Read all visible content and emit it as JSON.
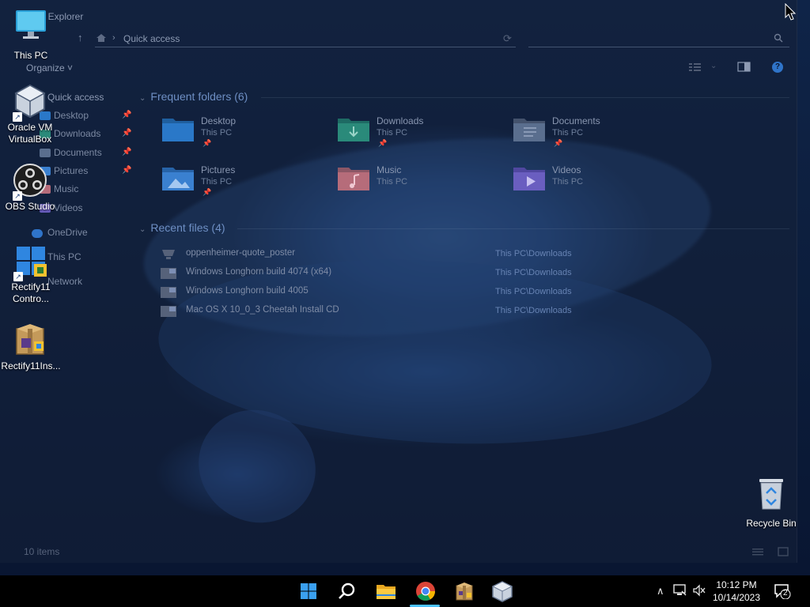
{
  "explorer": {
    "title": "File Explorer",
    "breadcrumb": "Quick access",
    "organize_label": "Organize ˅",
    "help_label": "?",
    "status_text": "10 items"
  },
  "nav": {
    "quick_access": "Quick access",
    "pinned": [
      {
        "label": "Desktop"
      },
      {
        "label": "Downloads"
      },
      {
        "label": "Documents"
      },
      {
        "label": "Pictures"
      },
      {
        "label": "Music"
      },
      {
        "label": "Videos"
      }
    ],
    "onedrive": "OneDrive",
    "this_pc": "This PC",
    "network": "Network"
  },
  "frequent": {
    "heading": "Frequent folders (6)",
    "folders": [
      {
        "name": "Desktop",
        "location": "This PC",
        "icon": "desktop-folder-icon"
      },
      {
        "name": "Downloads",
        "location": "This PC",
        "icon": "downloads-folder-icon"
      },
      {
        "name": "Documents",
        "location": "This PC",
        "icon": "documents-folder-icon"
      },
      {
        "name": "Pictures",
        "location": "This PC",
        "icon": "pictures-folder-icon"
      },
      {
        "name": "Music",
        "location": "This PC",
        "icon": "music-folder-icon"
      },
      {
        "name": "Videos",
        "location": "This PC",
        "icon": "videos-folder-icon"
      }
    ]
  },
  "recent": {
    "heading": "Recent files (4)",
    "files": [
      {
        "name": "oppenheimer-quote_poster",
        "location": "This PC\\Downloads"
      },
      {
        "name": "Windows Longhorn build 4074 (x64)",
        "location": "This PC\\Downloads"
      },
      {
        "name": "Windows Longhorn build 4005",
        "location": "This PC\\Downloads"
      },
      {
        "name": "Mac OS X 10_0_3 Cheetah Install CD",
        "location": "This PC\\Downloads"
      }
    ]
  },
  "desktop_icons": [
    {
      "label": "This PC",
      "icon": "computer-icon"
    },
    {
      "label": "Oracle VM VirtualBox",
      "icon": "virtualbox-icon"
    },
    {
      "label": "OBS Studio",
      "icon": "obs-icon"
    },
    {
      "label": "Rectify11 Contro...",
      "icon": "rectify11-control-icon"
    },
    {
      "label": "Rectify11Ins...",
      "icon": "installer-package-icon"
    },
    {
      "label": "Recycle Bin",
      "icon": "recycle-bin-icon"
    }
  ],
  "taskbar": {
    "apps": [
      "start-icon",
      "search-icon",
      "file-explorer-icon",
      "chrome-icon",
      "package-icon",
      "virtualbox-icon"
    ],
    "time": "10:12 PM",
    "date": "10/14/2023",
    "notification_count": "2",
    "accent": "#4cc2ff"
  }
}
